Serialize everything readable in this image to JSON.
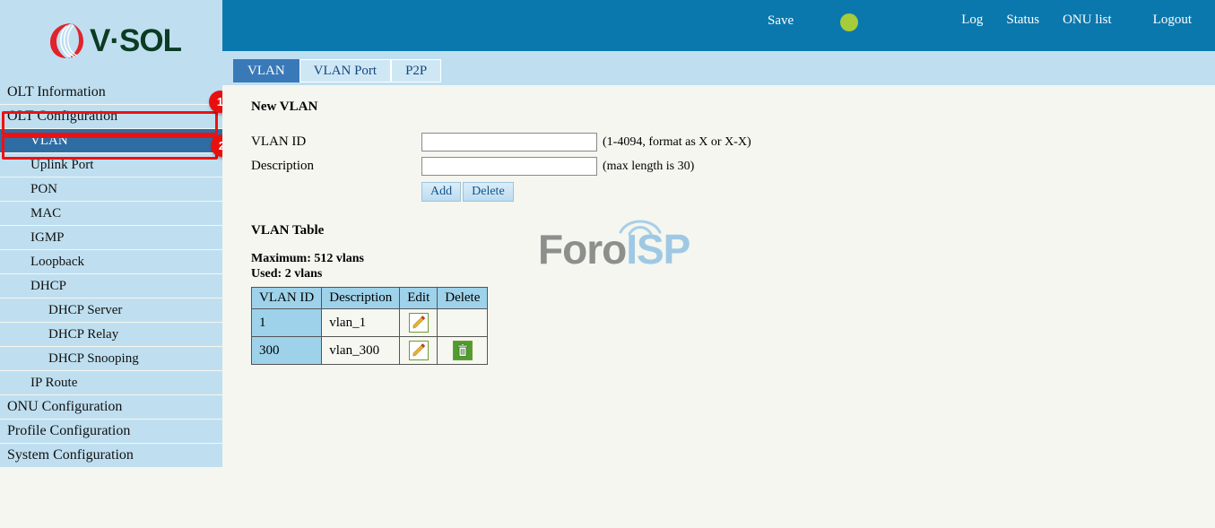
{
  "brand": {
    "logo_text": "V·SOL",
    "logo_icon": "vsol-swirl-icon",
    "logo_mark_color": "#e1232b",
    "logo_text_color": "#0c3b24"
  },
  "header": {
    "background_color": "#0b78ad",
    "save_label": "Save",
    "status_dot_color": "#a5cd39",
    "status_dot_name": "status-indicator",
    "links": [
      {
        "label": "Log"
      },
      {
        "label": "Status"
      },
      {
        "label": "ONU list"
      },
      {
        "label": "Logout"
      }
    ]
  },
  "tabs": {
    "active_color": "#3a79b8",
    "items": [
      {
        "label": "VLAN",
        "active": true
      },
      {
        "label": "VLAN Port",
        "active": false
      },
      {
        "label": "P2P",
        "active": false
      }
    ]
  },
  "sidebar": {
    "item_bg_color": "#bfdff0",
    "selected_bg_color": "#2e6da4",
    "items": [
      {
        "label": "OLT Information",
        "level": 1,
        "selected": false
      },
      {
        "label": "OLT Configuration",
        "level": 1,
        "selected": false
      },
      {
        "label": "VLAN",
        "level": 2,
        "selected": true
      },
      {
        "label": "Uplink Port",
        "level": 2,
        "selected": false
      },
      {
        "label": "PON",
        "level": 2,
        "selected": false
      },
      {
        "label": "MAC",
        "level": 2,
        "selected": false
      },
      {
        "label": "IGMP",
        "level": 2,
        "selected": false
      },
      {
        "label": "Loopback",
        "level": 2,
        "selected": false
      },
      {
        "label": "DHCP",
        "level": 2,
        "selected": false
      },
      {
        "label": "DHCP Server",
        "level": 3,
        "selected": false
      },
      {
        "label": "DHCP Relay",
        "level": 3,
        "selected": false
      },
      {
        "label": "DHCP Snooping",
        "level": 3,
        "selected": false
      },
      {
        "label": "IP Route",
        "level": 2,
        "selected": false
      },
      {
        "label": "ONU Configuration",
        "level": 1,
        "selected": false
      },
      {
        "label": "Profile Configuration",
        "level": 1,
        "selected": false
      },
      {
        "label": "System Configuration",
        "level": 1,
        "selected": false
      }
    ]
  },
  "annotations": {
    "color": "#ee1111",
    "badges": [
      {
        "number": "1",
        "target": "OLT Configuration"
      },
      {
        "number": "2",
        "target": "VLAN"
      }
    ]
  },
  "main": {
    "new_vlan_title": "New VLAN",
    "fields": [
      {
        "label": "VLAN ID",
        "value": "",
        "placeholder": "",
        "hint": "(1-4094, format as X or X-X)"
      },
      {
        "label": "Description",
        "value": "",
        "placeholder": "",
        "hint": "(max length is 30)"
      }
    ],
    "buttons": [
      {
        "label": "Add"
      },
      {
        "label": "Delete"
      }
    ],
    "table_title": "VLAN Table",
    "maximum_line": "Maximum: 512 vlans",
    "used_line": "Used: 2 vlans",
    "table": {
      "headers": [
        "VLAN ID",
        "Description",
        "Edit",
        "Delete"
      ],
      "rows": [
        {
          "vlan_id": "1",
          "description": "vlan_1",
          "edit": true,
          "delete": false
        },
        {
          "vlan_id": "300",
          "description": "vlan_300",
          "edit": true,
          "delete": true
        }
      ]
    }
  },
  "watermark": {
    "part1": "Foro",
    "part2": "ISP",
    "part1_color": "#8d8f8d",
    "part2_color": "#9fc8e4"
  }
}
